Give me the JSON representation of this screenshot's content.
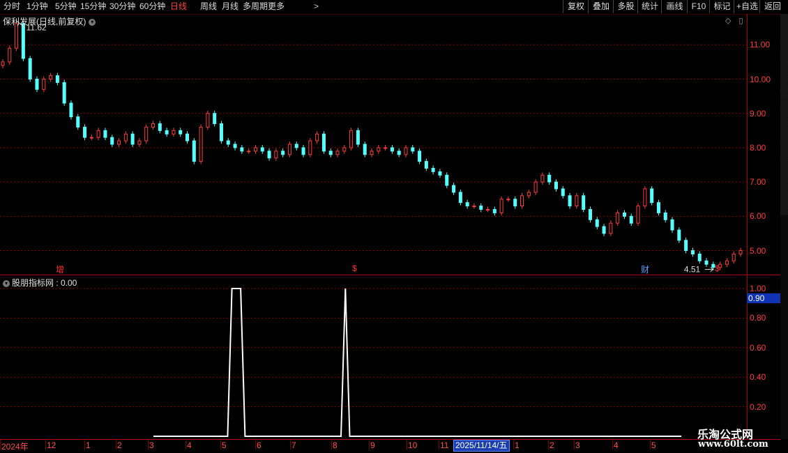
{
  "toolbar": {
    "timeframes": [
      "分时",
      "1分钟",
      "5分钟",
      "15分钟",
      "30分钟",
      "60分钟",
      "日线",
      "周线",
      "月线",
      "多周期",
      "更多"
    ],
    "active": "日线",
    "more_icon": "chevron-right-icon",
    "right_buttons": [
      "复权",
      "叠加",
      "多股",
      "统计",
      "画线",
      "F10",
      "标记",
      "+自选",
      "返回"
    ]
  },
  "main_chart": {
    "title": "保利发展(日线,前复权)",
    "title_icon": "chevron-down-icon",
    "high_label": "11.62",
    "low_label": "4.51",
    "price_labels": [
      "11.00",
      "10.00",
      "9.00",
      "8.00",
      "7.00",
      "6.00",
      "5.00"
    ],
    "event_markers": [
      {
        "text": "增",
        "color": "#ff3030"
      },
      {
        "text": "$",
        "color": "#ff3030"
      },
      {
        "text": "财",
        "color": "#5aa0ff"
      },
      {
        "text": "$",
        "color": "#ff3030"
      }
    ]
  },
  "sub_chart": {
    "title": "股朋指标网 : 0.00",
    "title_icon": "chevron-down-icon",
    "labels": [
      "1.00",
      "0.80",
      "0.60",
      "0.40",
      "0.20"
    ],
    "current_value": "0.90"
  },
  "time_axis": {
    "labels": [
      "2024年",
      "12",
      "1",
      "2",
      "3",
      "4",
      "5",
      "6",
      "7",
      "8",
      "9",
      "10",
      "11",
      "1",
      "2",
      "3",
      "4",
      "5"
    ],
    "current_date": "2025/11/14/五"
  },
  "watermark": {
    "title": "乐淘公式网",
    "url": "www.60lt.com"
  },
  "colors": {
    "up": "#ff3b3b",
    "down": "#54ffff",
    "grid": "#8b0000",
    "signal": "#ffffff",
    "axis": "#b00000"
  },
  "chart_data": [
    {
      "type": "candlestick",
      "title": "保利发展(日线,前复权)",
      "ylim": [
        4.3,
        11.9
      ],
      "grid": true,
      "series": [
        {
          "values": [
            10.5,
            10.9,
            11.62,
            10.6,
            10.0,
            9.7,
            10.0,
            10.1,
            9.9,
            9.3,
            8.9,
            8.6,
            8.3,
            8.3,
            8.5,
            8.3,
            8.1,
            8.2,
            8.4,
            8.1,
            8.2,
            8.6,
            8.7,
            8.5,
            8.4,
            8.5,
            8.4,
            8.2,
            7.6,
            8.6,
            9.0,
            8.7,
            8.2,
            8.1,
            8.0,
            7.9,
            7.9,
            8.0,
            7.9,
            7.7,
            7.9,
            7.8,
            8.1,
            8.0,
            7.8,
            8.2,
            8.4,
            7.9,
            7.8,
            7.9,
            8.0,
            8.5,
            8.1,
            7.8,
            7.9,
            8.0,
            8.0,
            7.9,
            7.8,
            8.0,
            7.9,
            7.6,
            7.4,
            7.3,
            7.2,
            6.9,
            6.7,
            6.4,
            6.3,
            6.3,
            6.2,
            6.2,
            6.1,
            6.5,
            6.5,
            6.3,
            6.6,
            6.7,
            7.0,
            7.2,
            7.0,
            6.8,
            6.6,
            6.3,
            6.6,
            6.2,
            5.9,
            5.7,
            5.5,
            5.8,
            6.1,
            6.0,
            5.8,
            6.3,
            6.8,
            6.4,
            6.1,
            5.9,
            5.6,
            5.3,
            5.0,
            4.9,
            4.7,
            4.6,
            4.51,
            4.6,
            4.7,
            4.9,
            5.0
          ]
        }
      ],
      "annotations": [
        "11.62",
        "4.51"
      ]
    },
    {
      "type": "line",
      "title": "股朋指标网",
      "ylim": [
        0,
        1.05
      ],
      "grid": true,
      "series": [
        {
          "values": [
            0,
            0,
            0,
            0,
            0,
            0,
            0,
            0,
            0,
            0,
            0,
            0,
            0,
            0,
            0,
            0,
            0,
            0,
            1,
            1,
            1,
            0,
            0,
            0,
            0,
            0,
            0,
            0,
            0,
            0,
            0,
            0,
            0,
            0,
            0,
            0,
            0,
            0,
            0,
            0,
            0,
            0,
            0,
            0,
            1,
            0,
            0,
            0,
            0,
            0,
            0,
            0,
            0,
            0,
            0,
            0,
            0,
            0,
            0,
            0,
            0,
            0,
            0,
            0,
            0,
            0,
            0,
            0,
            0,
            0,
            0,
            0,
            0,
            0,
            0,
            0,
            0,
            0,
            0,
            0,
            0,
            0,
            0,
            0,
            0,
            0,
            0,
            0,
            0,
            0,
            0,
            0,
            0,
            0,
            0,
            0,
            0,
            0,
            0,
            0,
            0,
            0,
            0,
            0,
            0,
            0,
            0,
            0,
            0,
            0,
            0,
            0,
            0,
            0,
            0,
            0,
            0,
            0,
            0,
            0,
            0,
            0
          ]
        }
      ]
    }
  ]
}
